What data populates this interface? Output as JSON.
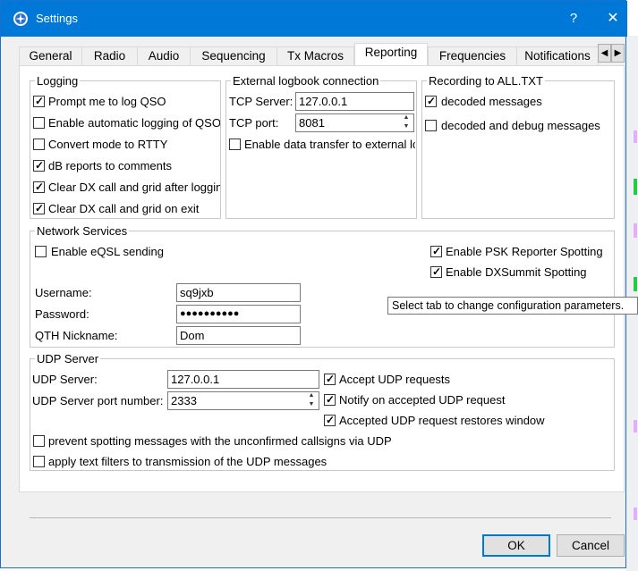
{
  "window": {
    "title": "Settings",
    "help_label": "?",
    "close_label": "✕",
    "accent_color": "#0078d7"
  },
  "tabs": [
    {
      "label": "General"
    },
    {
      "label": "Radio"
    },
    {
      "label": "Audio"
    },
    {
      "label": "Sequencing"
    },
    {
      "label": "Tx Macros"
    },
    {
      "label": "Reporting",
      "active": true
    },
    {
      "label": "Frequencies"
    },
    {
      "label": "Notifications"
    }
  ],
  "tab_scroll": {
    "left": "◀",
    "right": "▶"
  },
  "logging": {
    "title": "Logging",
    "items": [
      {
        "label": "Prompt me to log QSO",
        "checked": true
      },
      {
        "label": "Enable automatic logging of QSO",
        "checked": false
      },
      {
        "label": "Convert mode to RTTY",
        "checked": false
      },
      {
        "label": "dB reports to comments",
        "checked": true
      },
      {
        "label": "Clear DX call and grid after logging",
        "checked": true
      },
      {
        "label": "Clear DX call and grid on exit",
        "checked": true
      }
    ]
  },
  "external_logbook": {
    "title": "External logbook connection",
    "tcp_server_label": "TCP Server:",
    "tcp_server_value": "127.0.0.1",
    "tcp_port_label": "TCP port:",
    "tcp_port_value": "8081",
    "enable_transfer_label": "Enable data transfer to external logbook",
    "enable_transfer_checked": false
  },
  "recording": {
    "title": "Recording to ALL.TXT",
    "items": [
      {
        "label": "decoded messages",
        "checked": true
      },
      {
        "label": "decoded and debug messages",
        "checked": false
      }
    ]
  },
  "network": {
    "title": "Network Services",
    "eqsl_label": "Enable eQSL sending",
    "eqsl_checked": false,
    "psk_label": "Enable PSK Reporter Spotting",
    "psk_checked": true,
    "dxsummit_label": "Enable DXSummit Spotting",
    "dxsummit_checked": true,
    "username_label": "Username:",
    "username_value": "sq9jxb",
    "password_label": "Password:",
    "password_value": "●●●●●●●●●●",
    "qth_label": "QTH Nickname:",
    "qth_value": "Dom"
  },
  "tooltip": "Select tab to change configuration parameters.",
  "udp": {
    "title": "UDP Server",
    "server_label": "UDP Server:",
    "server_value": "127.0.0.1",
    "port_label": "UDP Server port number:",
    "port_value": "2333",
    "accept_label": "Accept UDP requests",
    "accept_checked": true,
    "notify_label": "Notify on accepted UDP request",
    "notify_checked": true,
    "restore_label": "Accepted UDP request restores window",
    "restore_checked": true,
    "prevent_label": "prevent spotting messages with the unconfirmed callsigns via UDP",
    "prevent_checked": false,
    "filters_label": "apply text filters to transmission of the UDP messages",
    "filters_checked": false
  },
  "buttons": {
    "ok": "OK",
    "cancel": "Cancel"
  },
  "check_glyph": "✓"
}
